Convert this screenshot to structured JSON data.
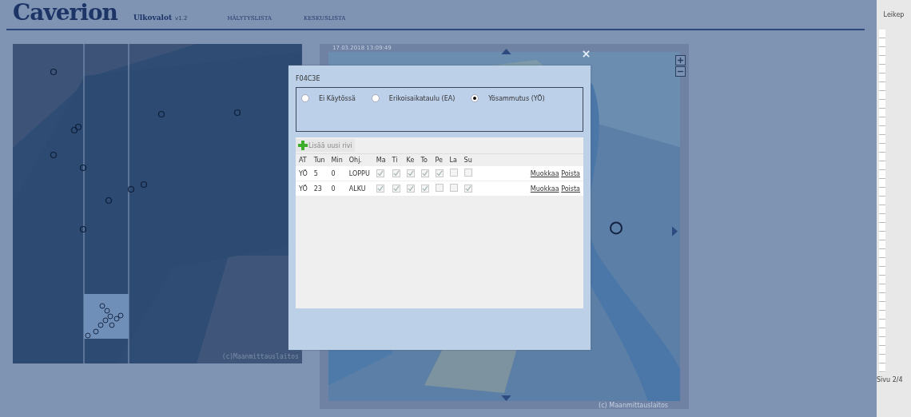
{
  "header": {
    "logo": "Caverion",
    "app_name": "Ulkovalot",
    "version": "v1.2",
    "nav": [
      {
        "label": "HÄLYTYSLISTA"
      },
      {
        "label": "KESKUSLISTA"
      }
    ]
  },
  "left_map": {
    "copyright": "(c)Maanmittauslaitos"
  },
  "right_map": {
    "timestamp": "17.03.2018 13:09:49",
    "copyright": "(c) Maanmittauslaitos"
  },
  "dialog": {
    "title": "F04C3E",
    "modes": [
      {
        "label": "Ei Käytössä",
        "selected": false
      },
      {
        "label": "Erikoisaikataulu (EA)",
        "selected": false
      },
      {
        "label": "Yösammutus (YÖ)",
        "selected": true
      }
    ],
    "add_button": "Lisää uusi rivi",
    "columns": [
      "AT",
      "Tun",
      "Min",
      "Ohj.",
      "Ma",
      "Ti",
      "Ke",
      "To",
      "Pe",
      "La",
      "Su"
    ],
    "rows": [
      {
        "at": "YÖ",
        "tun": "5",
        "min": "0",
        "ohj": "LOPPU",
        "days": [
          true,
          true,
          true,
          true,
          true,
          false,
          false
        ],
        "edit": "Muokkaa",
        "delete": "Poista"
      },
      {
        "at": "YÖ",
        "tun": "23",
        "min": "0",
        "ohj": "ALKU",
        "days": [
          true,
          true,
          true,
          true,
          false,
          false,
          true
        ],
        "edit": "Muokkaa",
        "delete": "Poista"
      }
    ]
  },
  "side_panel": {
    "clipboard": "Leikep",
    "page": "Sivu 2/4"
  }
}
